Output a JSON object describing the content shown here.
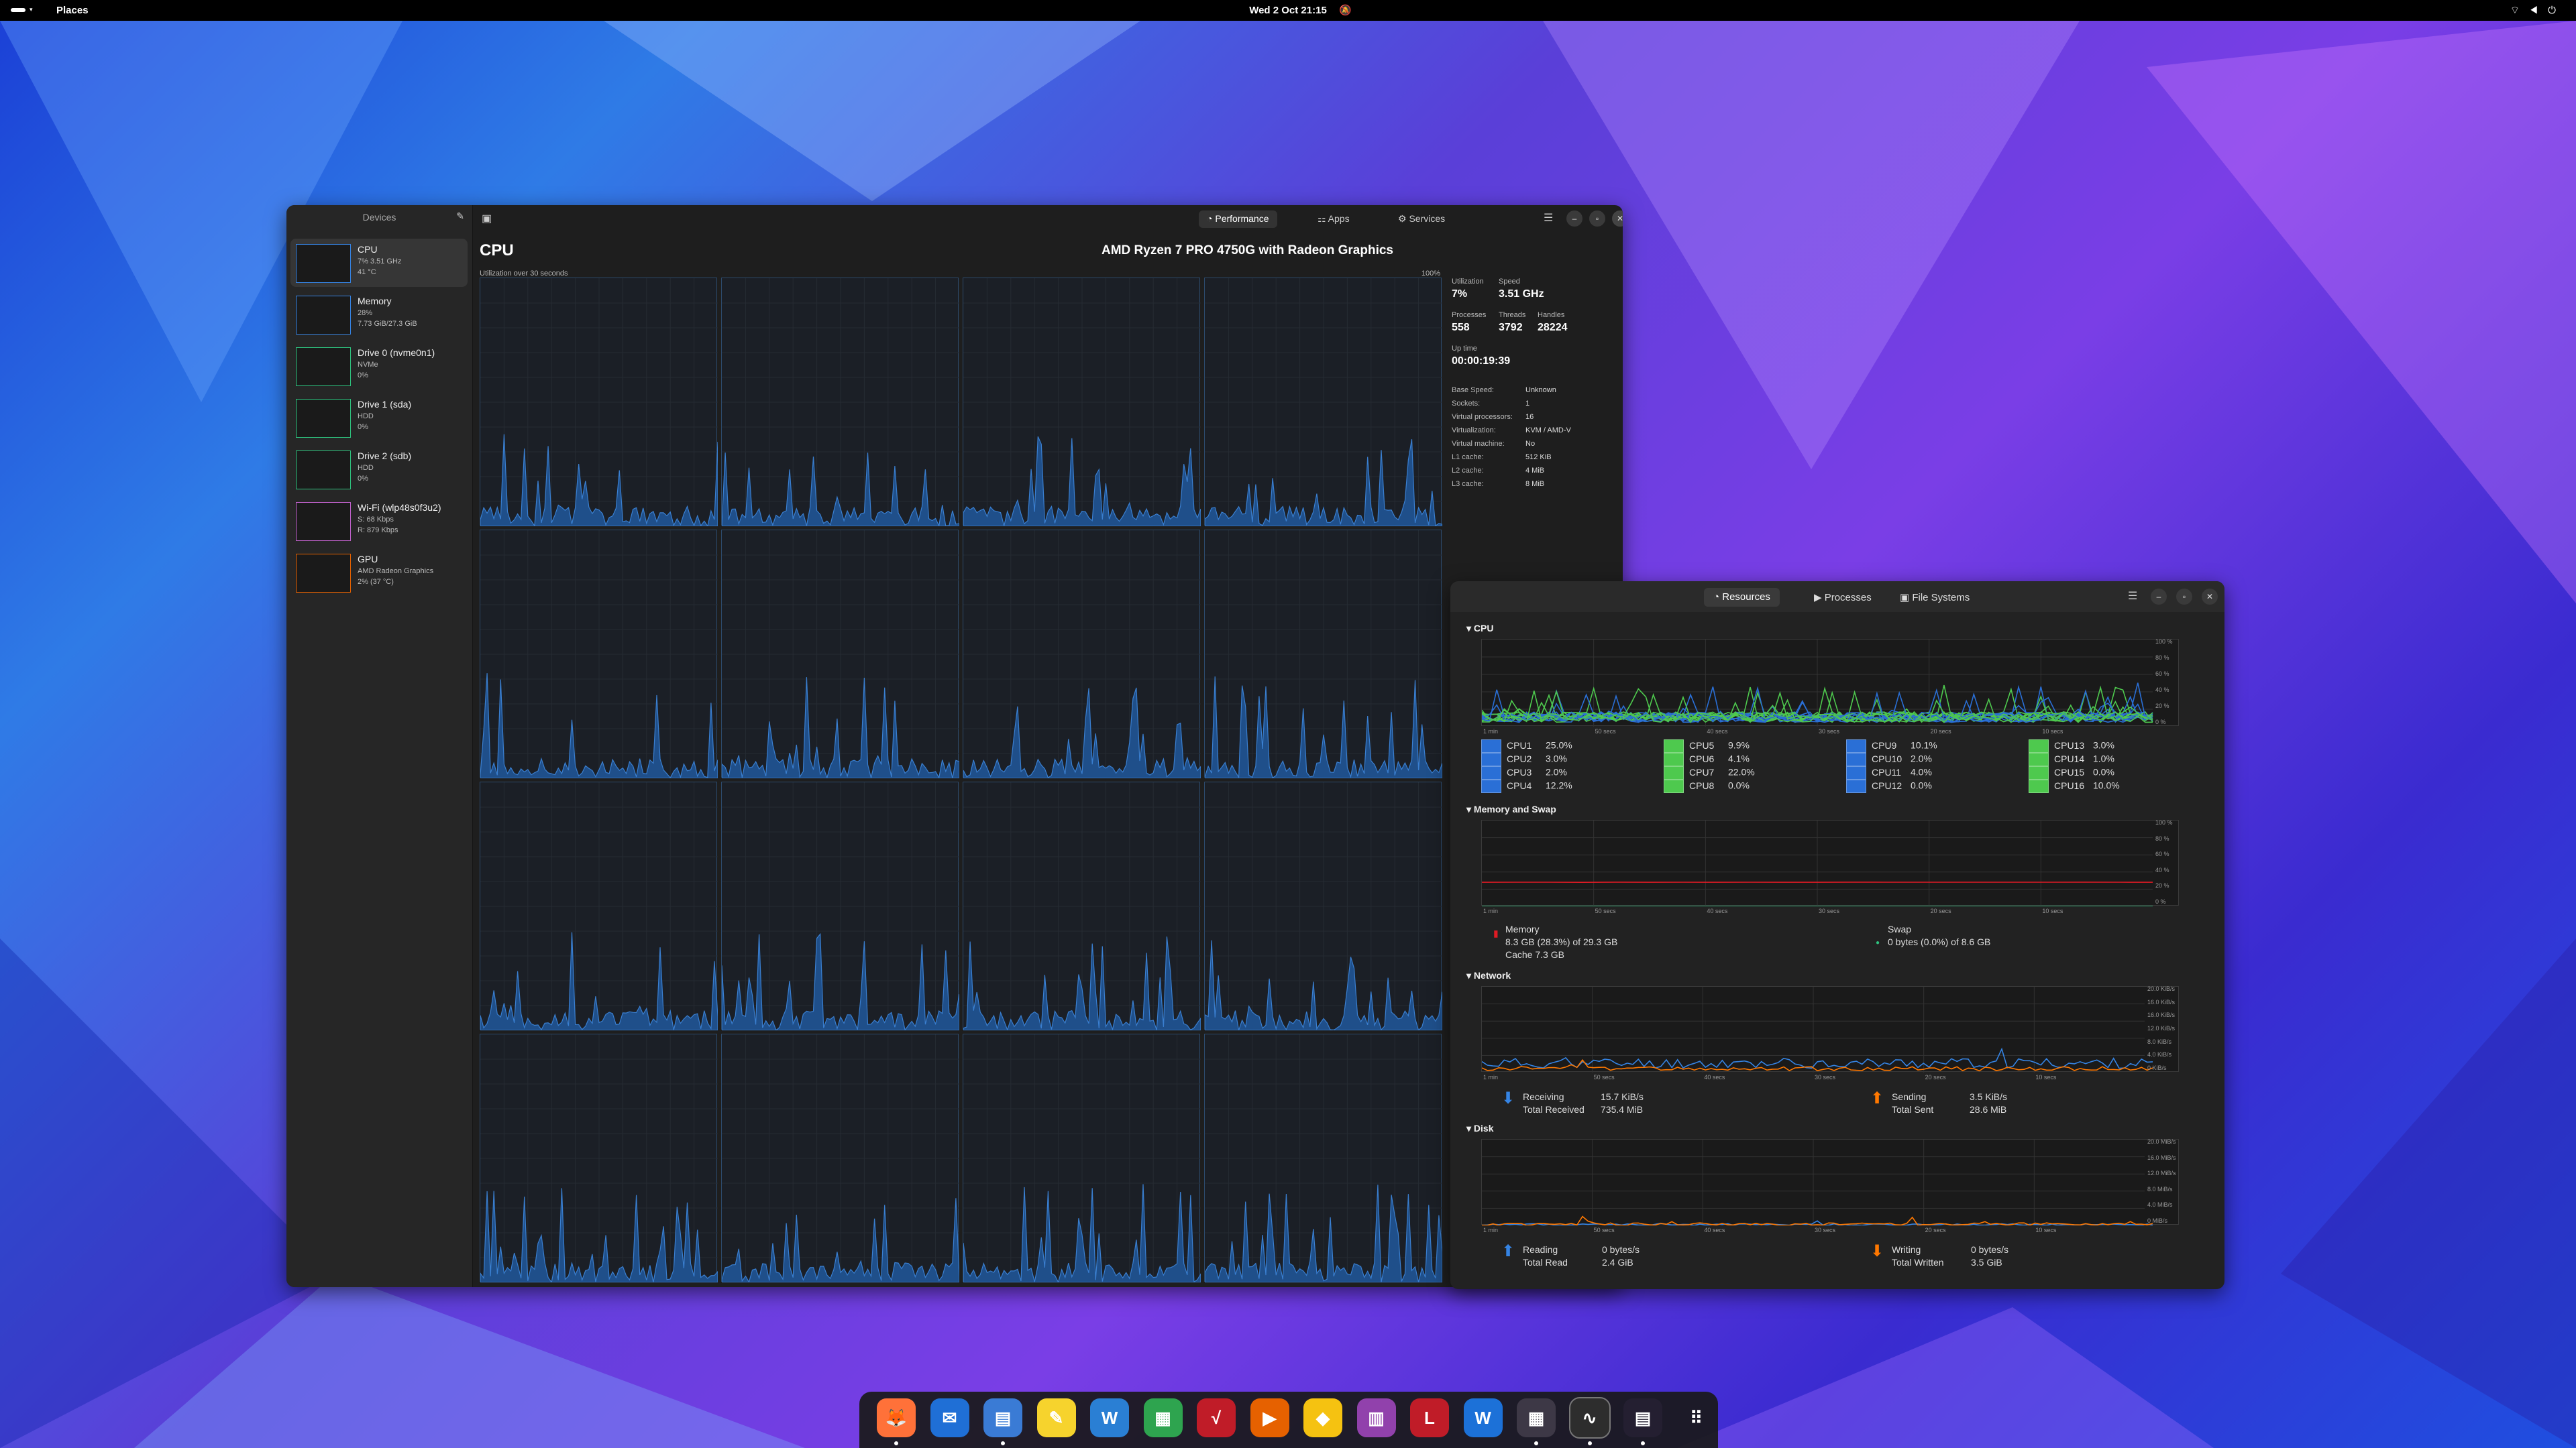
{
  "topbar": {
    "activities_label": "",
    "places": "Places",
    "clock": "Wed 2 Oct  21:15",
    "tray_icons": [
      "wifi-icon",
      "volume-icon",
      "battery-icon",
      "power-icon"
    ]
  },
  "mission_center": {
    "sidebar_title": "Devices",
    "devices": [
      {
        "name": "CPU",
        "line2": "7% 3.51 GHz",
        "line3": "41 °C"
      },
      {
        "name": "Memory",
        "line2": "28%",
        "line3": "7.73 GiB/27.3 GiB"
      },
      {
        "name": "Drive 0 (nvme0n1)",
        "line2": "NVMe",
        "line3": "0%"
      },
      {
        "name": "Drive 1 (sda)",
        "line2": "HDD",
        "line3": "0%"
      },
      {
        "name": "Drive 2 (sdb)",
        "line2": "HDD",
        "line3": "0%"
      },
      {
        "name": "Wi-Fi (wlp48s0f3u2)",
        "line2": "S: 68 Kbps",
        "line3": "R: 879 Kbps"
      },
      {
        "name": "GPU",
        "line2": "AMD Radeon Graphics",
        "line3": "2% (37 °C)"
      }
    ],
    "tabs": [
      "Performance",
      "Apps",
      "Services"
    ],
    "cpu_title": "CPU",
    "cpu_subtitle": "Utilization over 30 seconds",
    "cpu_model": "AMD Ryzen 7 PRO 4750G with Radeon Graphics",
    "graph_max": "100%",
    "stats": {
      "utilization_label": "Utilization",
      "utilization": "7%",
      "speed_label": "Speed",
      "speed": "3.51 GHz",
      "processes_label": "Processes",
      "processes": "558",
      "threads_label": "Threads",
      "threads": "3792",
      "handles_label": "Handles",
      "handles": "28224",
      "uptime_label": "Up time",
      "uptime": "00:00:19:39"
    },
    "details": [
      {
        "k": "Base Speed:",
        "v": "Unknown"
      },
      {
        "k": "Sockets:",
        "v": "1"
      },
      {
        "k": "Virtual processors:",
        "v": "16"
      },
      {
        "k": "Virtualization:",
        "v": "KVM / AMD-V"
      },
      {
        "k": "Virtual machine:",
        "v": "No"
      },
      {
        "k": "L1 cache:",
        "v": "512 KiB"
      },
      {
        "k": "L2 cache:",
        "v": "4 MiB"
      },
      {
        "k": "L3 cache:",
        "v": "8 MiB"
      }
    ]
  },
  "resources": {
    "tabs": [
      "Resources",
      "Processes",
      "File Systems"
    ],
    "sections": {
      "cpu": "CPU",
      "memory": "Memory and Swap",
      "network": "Network",
      "disk": "Disk"
    },
    "time_axis": [
      "1 min",
      "50 secs",
      "40 secs",
      "30 secs",
      "20 secs",
      "10 secs"
    ],
    "pct_axis": [
      "100 %",
      "80 %",
      "60 %",
      "40 %",
      "20 %",
      "0 %"
    ],
    "net_axis": [
      "20.0 KiB/s",
      "16.0 KiB/s",
      "16.0 KiB/s",
      "12.0 KiB/s",
      "8.0 KiB/s",
      "4.0 KiB/s",
      "0 KiB/s"
    ],
    "disk_axis": [
      "20.0 MiB/s",
      "16.0 MiB/s",
      "12.0 MiB/s",
      "8.0 MiB/s",
      "4.0 MiB/s",
      "0 MiB/s"
    ],
    "cpus": [
      {
        "name": "CPU1",
        "val": "25.0%"
      },
      {
        "name": "CPU2",
        "val": "3.0%"
      },
      {
        "name": "CPU3",
        "val": "2.0%"
      },
      {
        "name": "CPU4",
        "val": "12.2%"
      },
      {
        "name": "CPU5",
        "val": "9.9%"
      },
      {
        "name": "CPU6",
        "val": "4.1%"
      },
      {
        "name": "CPU7",
        "val": "22.0%"
      },
      {
        "name": "CPU8",
        "val": "0.0%"
      },
      {
        "name": "CPU9",
        "val": "10.1%"
      },
      {
        "name": "CPU10",
        "val": "2.0%"
      },
      {
        "name": "CPU11",
        "val": "4.0%"
      },
      {
        "name": "CPU12",
        "val": "0.0%"
      },
      {
        "name": "CPU13",
        "val": "3.0%"
      },
      {
        "name": "CPU14",
        "val": "1.0%"
      },
      {
        "name": "CPU15",
        "val": "0.0%"
      },
      {
        "name": "CPU16",
        "val": "10.0%"
      }
    ],
    "memory": {
      "label": "Memory",
      "value": "8.3 GB (28.3%) of 29.3 GB",
      "cache": "Cache 7.3 GB"
    },
    "swap": {
      "label": "Swap",
      "value": "0 bytes (0.0%) of 8.6 GB"
    },
    "network": {
      "recv_label": "Receiving",
      "recv": "15.7 KiB/s",
      "total_recv_label": "Total Received",
      "total_recv": "735.4 MiB",
      "send_label": "Sending",
      "send": "3.5 KiB/s",
      "total_sent_label": "Total Sent",
      "total_sent": "28.6 MiB"
    },
    "disk": {
      "read_label": "Reading",
      "read": "0 bytes/s",
      "total_read_label": "Total Read",
      "total_read": "2.4 GiB",
      "write_label": "Writing",
      "write": "0 bytes/s",
      "total_written_label": "Total Written",
      "total_written": "3.5 GiB"
    }
  },
  "colors": {
    "accent_blue": "#3584e4",
    "cpu_blue": "#2a6fd6",
    "cpu_green": "#4ec94e",
    "mem_red": "#e01b24",
    "send_orange": "#ff7800"
  },
  "dock": [
    "firefox-icon",
    "thunderbird-icon",
    "files-icon",
    "text-editor-icon",
    "writer-icon",
    "calc-icon",
    "math-icon",
    "impress-icon",
    "draw-icon",
    "base-icon",
    "libreoffice-icon",
    "kvm-icon",
    "system-monitor-icon",
    "mission-center-icon",
    "resources-icon",
    "app-grid-icon"
  ]
}
